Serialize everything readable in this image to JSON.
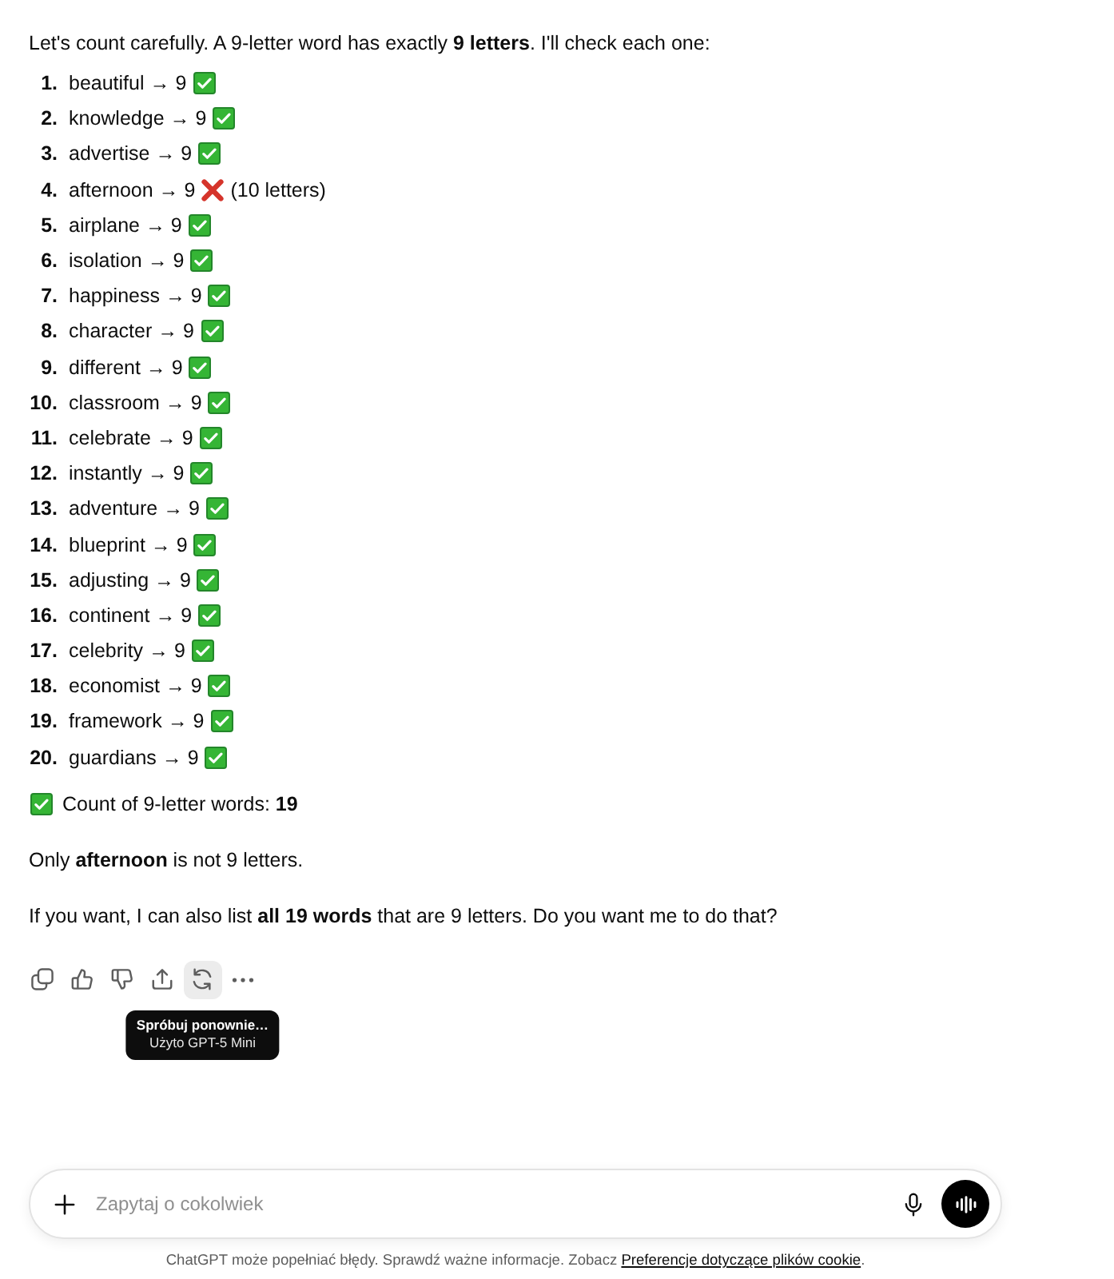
{
  "message": {
    "intro": "Let's count carefully. A 9-letter word has exactly **9 letters**. I'll check each one:",
    "items": [
      {
        "number": "1.",
        "text": "beautiful → 9",
        "kind": "correct"
      },
      {
        "number": "2.",
        "text": "knowledge → 9",
        "kind": "correct"
      },
      {
        "number": "3.",
        "text": "advertise → 9",
        "kind": "correct"
      },
      {
        "number": "4.",
        "text": "afternoon → 9",
        "kind": "incorrect",
        "note": "(10 letters)"
      },
      {
        "number": "5.",
        "text": "airplane → 9",
        "kind": "correct"
      },
      {
        "number": "6.",
        "text": "isolation → 9",
        "kind": "correct"
      },
      {
        "number": "7.",
        "text": "happiness → 9",
        "kind": "correct"
      },
      {
        "number": "8.",
        "text": "character → 9",
        "kind": "correct"
      },
      {
        "number": "9.",
        "text": "different → 9",
        "kind": "correct"
      },
      {
        "number": "10.",
        "text": "classroom → 9",
        "kind": "correct"
      },
      {
        "number": "11.",
        "text": "celebrate → 9",
        "kind": "correct"
      },
      {
        "number": "12.",
        "text": "instantly → 9",
        "kind": "correct"
      },
      {
        "number": "13.",
        "text": "adventure → 9",
        "kind": "correct"
      },
      {
        "number": "14.",
        "text": "blueprint → 9",
        "kind": "correct"
      },
      {
        "number": "15.",
        "text": "adjusting → 9",
        "kind": "correct"
      },
      {
        "number": "16.",
        "text": "continent → 9",
        "kind": "correct"
      },
      {
        "number": "17.",
        "text": "celebrity → 9",
        "kind": "correct"
      },
      {
        "number": "18.",
        "text": "economist → 9",
        "kind": "correct"
      },
      {
        "number": "19.",
        "text": "framework → 9",
        "kind": "correct"
      },
      {
        "number": "20.",
        "text": "guardians → 9",
        "kind": "correct"
      }
    ],
    "summary": "Count of 9-letter words: **19**",
    "paragraphs": [
      "Only **afternoon** is not 9 letters.",
      "If you want, I can also list **all 19 words** that are 9 letters. Do you want me to do that?"
    ]
  },
  "actions": [
    {
      "kind": "copy",
      "hovered": false
    },
    {
      "kind": "thumbs_up",
      "hovered": false
    },
    {
      "kind": "thumbs_down",
      "hovered": false
    },
    {
      "kind": "share",
      "hovered": false
    },
    {
      "kind": "retry",
      "hovered": true
    },
    {
      "kind": "more",
      "hovered": false
    }
  ],
  "tooltip": {
    "title": "Spróbuj ponownie…",
    "subtitle": "Użyto GPT-5 Mini"
  },
  "composer": {
    "placeholder": "Zapytaj o cokolwiek"
  },
  "footer": {
    "text": "ChatGPT może popełniać błędy. Sprawdź ważne informacje. Zobacz",
    "link": "Preferencje dotyczące plików cookie",
    "suffix": "."
  }
}
